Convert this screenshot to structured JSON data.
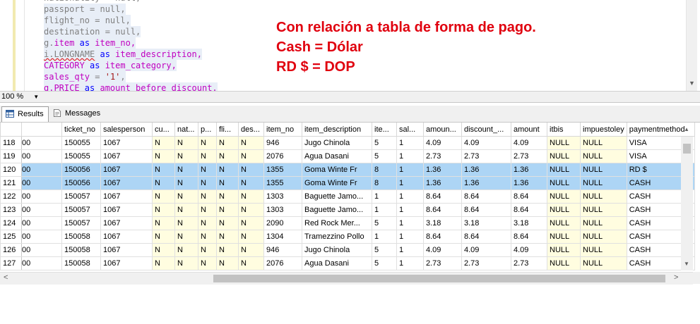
{
  "code_lines": [
    [
      {
        "t": "nationality = null,",
        "c": "gray"
      }
    ],
    [
      {
        "t": "passport = null,",
        "c": "gray"
      }
    ],
    [
      {
        "t": "flight_no = null,",
        "c": "gray"
      }
    ],
    [
      {
        "t": "destination = null,",
        "c": "gray"
      }
    ],
    [
      {
        "t": "g",
        "c": "gray"
      },
      {
        "t": ".",
        "c": "gray"
      },
      {
        "t": "item",
        "c": "kf"
      },
      {
        "t": " as ",
        "c": "kw"
      },
      {
        "t": "item_no,",
        "c": "kf"
      }
    ],
    [
      {
        "t": "i.LONGNAME",
        "c": "squig"
      },
      {
        "t": " as ",
        "c": "kw"
      },
      {
        "t": "item_description,",
        "c": "kf"
      }
    ],
    [
      {
        "t": "CATEGORY",
        "c": "kf"
      },
      {
        "t": " as ",
        "c": "kw"
      },
      {
        "t": "item_category,",
        "c": "kf"
      }
    ],
    [
      {
        "t": "sales_qty",
        "c": "kf"
      },
      {
        "t": " = ",
        "c": "gray"
      },
      {
        "t": "'1'",
        "c": "str"
      },
      {
        "t": ",",
        "c": "gray"
      }
    ],
    [
      {
        "t": "g.PRICE",
        "c": "kf"
      },
      {
        "t": " as ",
        "c": "kw"
      },
      {
        "t": "amount before discount.",
        "c": "kf"
      }
    ]
  ],
  "note": {
    "line1": "Con relación a tabla de forma de pago.",
    "line2": "Cash = Dólar",
    "line3": "RD $ = DOP"
  },
  "zoom": {
    "value": "100 %"
  },
  "tabs": {
    "results": "Results",
    "messages": "Messages"
  },
  "grid": {
    "columns": [
      "ticket_no",
      "salesperson",
      "cu...",
      "nat...",
      "p...",
      "fli...",
      "des...",
      "item_no",
      "item_description",
      "ite...",
      "sal...",
      "amoun...",
      "discount_...",
      "amount",
      "itbis",
      "impuestoley",
      "paymentmethod"
    ],
    "rows": [
      {
        "num": "118",
        "cut": "00",
        "cells": [
          "150055",
          "1067",
          "N",
          "N",
          "N",
          "N",
          "N",
          "946",
          "Jugo Chinola",
          "5",
          "1",
          "4.09",
          "4.09",
          "4.09",
          "NULL",
          "NULL",
          "VISA"
        ],
        "selected": false
      },
      {
        "num": "119",
        "cut": "00",
        "cells": [
          "150055",
          "1067",
          "N",
          "N",
          "N",
          "N",
          "N",
          "2076",
          "Agua Dasani",
          "5",
          "1",
          "2.73",
          "2.73",
          "2.73",
          "NULL",
          "NULL",
          "VISA"
        ],
        "selected": false
      },
      {
        "num": "120",
        "cut": "00",
        "cells": [
          "150056",
          "1067",
          "N",
          "N",
          "N",
          "N",
          "N",
          "1355",
          "Goma Winte Fr",
          "8",
          "1",
          "1.36",
          "1.36",
          "1.36",
          "NULL",
          "NULL",
          "RD $"
        ],
        "selected": true
      },
      {
        "num": "121",
        "cut": "00",
        "cells": [
          "150056",
          "1067",
          "N",
          "N",
          "N",
          "N",
          "N",
          "1355",
          "Goma Winte Fr",
          "8",
          "1",
          "1.36",
          "1.36",
          "1.36",
          "NULL",
          "NULL",
          "CASH"
        ],
        "selected": true
      },
      {
        "num": "122",
        "cut": "00",
        "cells": [
          "150057",
          "1067",
          "N",
          "N",
          "N",
          "N",
          "N",
          "1303",
          "Baguette Jamo...",
          "1",
          "1",
          "8.64",
          "8.64",
          "8.64",
          "NULL",
          "NULL",
          "CASH"
        ],
        "selected": false
      },
      {
        "num": "123",
        "cut": "00",
        "cells": [
          "150057",
          "1067",
          "N",
          "N",
          "N",
          "N",
          "N",
          "1303",
          "Baguette Jamo...",
          "1",
          "1",
          "8.64",
          "8.64",
          "8.64",
          "NULL",
          "NULL",
          "CASH"
        ],
        "selected": false
      },
      {
        "num": "124",
        "cut": "00",
        "cells": [
          "150057",
          "1067",
          "N",
          "N",
          "N",
          "N",
          "N",
          "2090",
          "Red Rock Mer...",
          "5",
          "1",
          "3.18",
          "3.18",
          "3.18",
          "NULL",
          "NULL",
          "CASH"
        ],
        "selected": false
      },
      {
        "num": "125",
        "cut": "00",
        "cells": [
          "150058",
          "1067",
          "N",
          "N",
          "N",
          "N",
          "N",
          "1304",
          "Tramezzino Pollo",
          "1",
          "1",
          "8.64",
          "8.64",
          "8.64",
          "NULL",
          "NULL",
          "CASH"
        ],
        "selected": false
      },
      {
        "num": "126",
        "cut": "00",
        "cells": [
          "150058",
          "1067",
          "N",
          "N",
          "N",
          "N",
          "N",
          "946",
          "Jugo Chinola",
          "5",
          "1",
          "4.09",
          "4.09",
          "4.09",
          "NULL",
          "NULL",
          "CASH"
        ],
        "selected": false
      },
      {
        "num": "127",
        "cut": "00",
        "cells": [
          "150058",
          "1067",
          "N",
          "N",
          "N",
          "N",
          "N",
          "2076",
          "Agua Dasani",
          "5",
          "1",
          "2.73",
          "2.73",
          "2.73",
          "NULL",
          "NULL",
          "CASH"
        ],
        "selected": false
      }
    ]
  }
}
